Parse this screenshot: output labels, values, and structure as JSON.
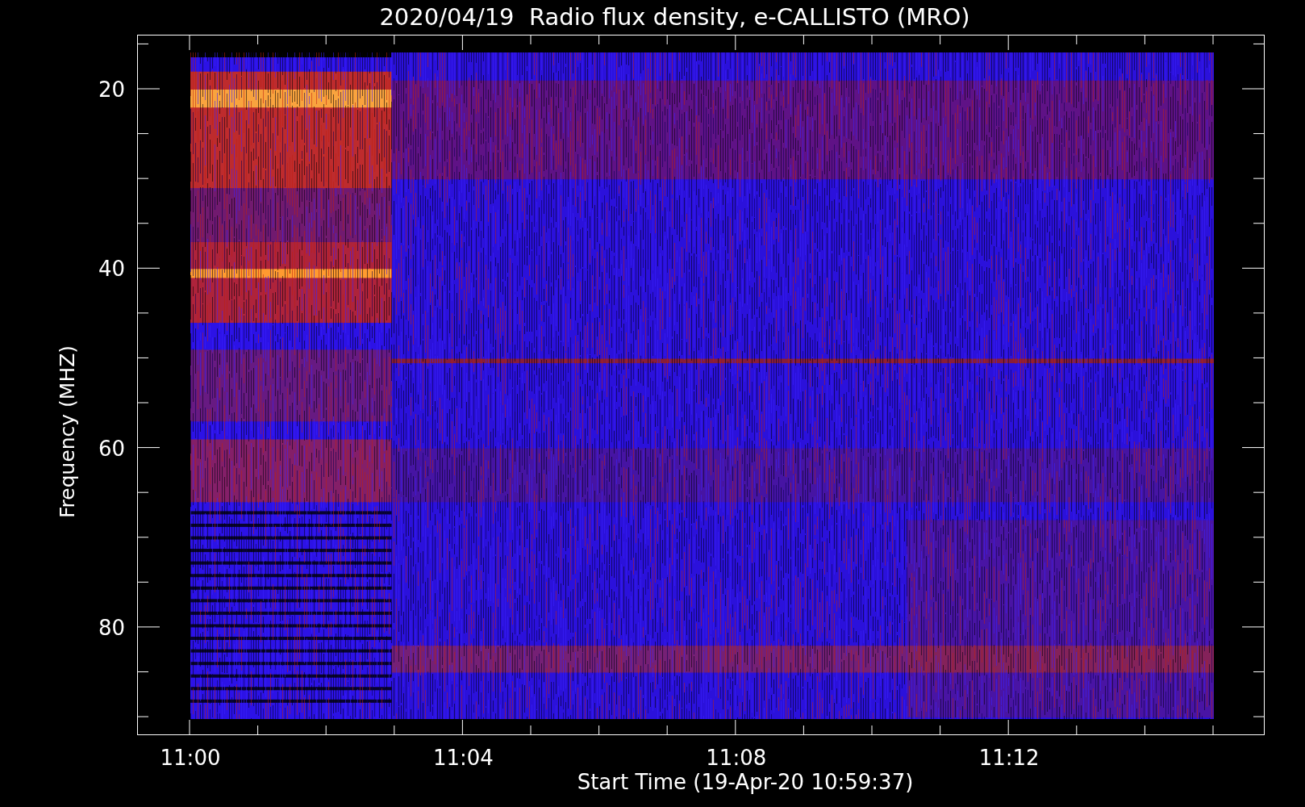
{
  "title": "2020/04/19  Radio flux density, e-CALLISTO (MRO)",
  "y_axis": {
    "label": "Frequency (MHZ)",
    "ticks": [
      "20",
      "40",
      "60",
      "80"
    ]
  },
  "x_axis": {
    "label": "Start Time (19-Apr-20 10:59:37)",
    "ticks": [
      "11:00",
      "11:04",
      "11:08",
      "11:12"
    ]
  }
}
